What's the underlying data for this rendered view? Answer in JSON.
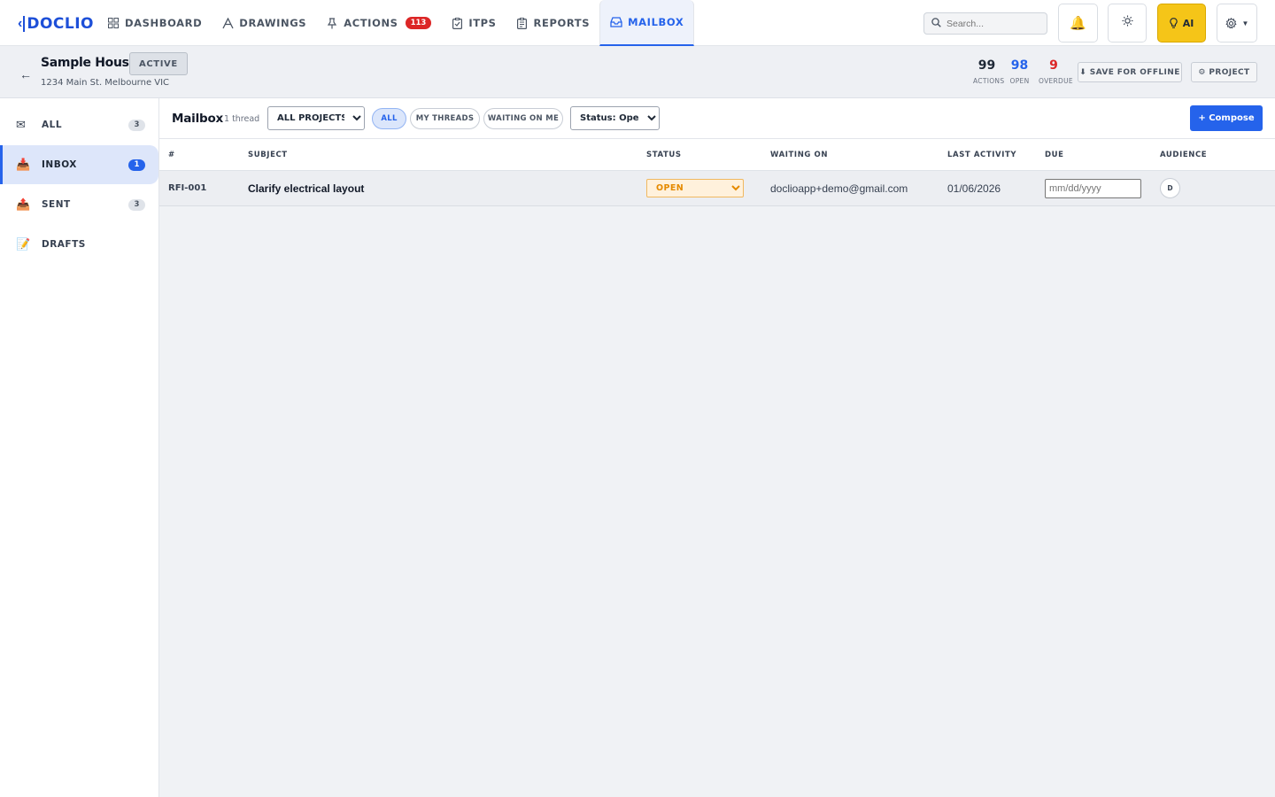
{
  "app": {
    "logo_text": "DOCLIO",
    "colors": {
      "accent": "#2563eb",
      "danger": "#dc2626",
      "ai": "#f5c518",
      "open_status": "#e58a00"
    }
  },
  "nav": {
    "items": [
      {
        "label": "DASHBOARD",
        "icon": "grid-icon"
      },
      {
        "label": "DRAWINGS",
        "icon": "pen-icon"
      },
      {
        "label": "ACTIONS",
        "icon": "pin-icon",
        "badge": "113"
      },
      {
        "label": "ITPS",
        "icon": "clipboard-check-icon"
      },
      {
        "label": "REPORTS",
        "icon": "clipboard-list-icon"
      },
      {
        "label": "MAILBOX",
        "icon": "inbox-icon",
        "active": true
      }
    ],
    "search_placeholder": "Search...",
    "ai_label": "AI"
  },
  "project": {
    "name": "Sample House",
    "status": "ACTIVE",
    "address": "1234 Main St. Melbourne VIC",
    "stats": [
      {
        "value": "99",
        "label": "ACTIONS",
        "color": "#111827"
      },
      {
        "value": "98",
        "label": "OPEN",
        "color": "#2563eb"
      },
      {
        "value": "9",
        "label": "OVERDUE",
        "color": "#dc2626"
      }
    ],
    "save_offline_label": "⬇ SAVE FOR OFFLINE",
    "project_button_label": "⚙ PROJECT"
  },
  "sidebar": {
    "items": [
      {
        "label": "ALL",
        "icon": "envelope-icon",
        "count": "3"
      },
      {
        "label": "INBOX",
        "icon": "inbox-tray-icon",
        "count": "1",
        "active": true
      },
      {
        "label": "SENT",
        "icon": "outbox-tray-icon",
        "count": "3"
      },
      {
        "label": "DRAFTS",
        "icon": "memo-icon"
      }
    ]
  },
  "mailbox": {
    "title": "Mailbox",
    "thread_count": "1 thread",
    "project_filter": "ALL PROJECTS",
    "pills": [
      "ALL",
      "MY THREADS",
      "WAITING ON ME"
    ],
    "status_filter": "Status: Open",
    "compose_label": "+ Compose",
    "columns": [
      "#",
      "SUBJECT",
      "STATUS",
      "WAITING ON",
      "LAST ACTIVITY",
      "DUE",
      "AUDIENCE"
    ],
    "rows": [
      {
        "id": "RFI-001",
        "subject": "Clarify electrical layout",
        "status": "OPEN",
        "waiting_on": "doclioapp+demo@gmail.com",
        "last_activity": "01/06/2026",
        "due_placeholder": "mm/dd/yyyy",
        "audience": "D"
      }
    ]
  }
}
